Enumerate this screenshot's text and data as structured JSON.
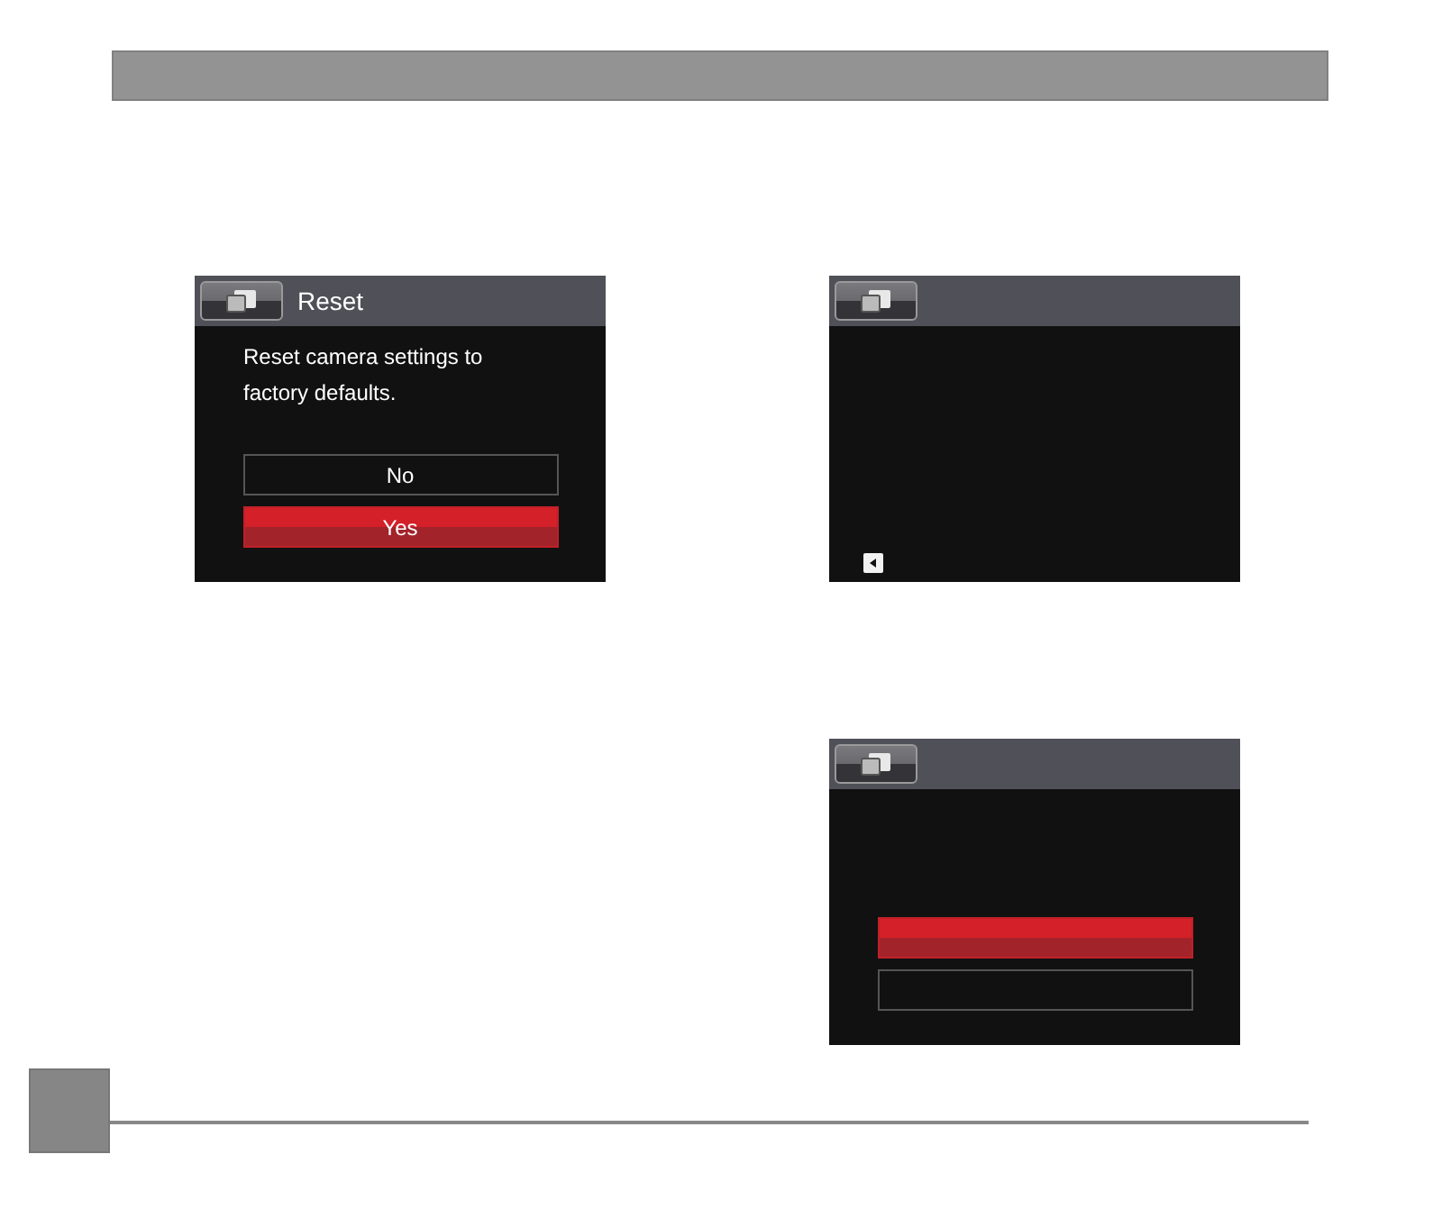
{
  "screens": [
    {
      "kind": "dialog",
      "title": "Reset",
      "message": "Reset camera settings to factory defaults.",
      "options": [
        {
          "label": "No",
          "selected": false
        },
        {
          "label": "Yes",
          "selected": true
        }
      ]
    },
    {
      "kind": "back"
    },
    {
      "kind": "dialog",
      "options": [
        {
          "selected": true
        },
        {
          "selected": false
        }
      ]
    }
  ]
}
